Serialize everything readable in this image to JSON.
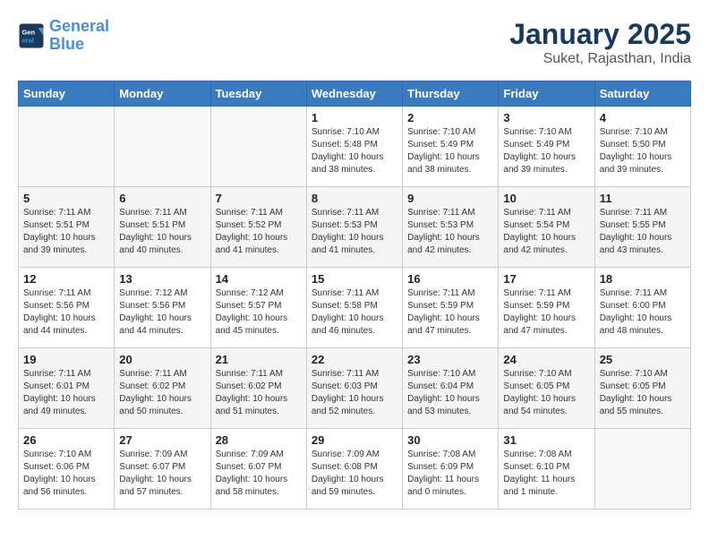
{
  "logo": {
    "line1": "General",
    "line2": "Blue"
  },
  "title": "January 2025",
  "subtitle": "Suket, Rajasthan, India",
  "days_of_week": [
    "Sunday",
    "Monday",
    "Tuesday",
    "Wednesday",
    "Thursday",
    "Friday",
    "Saturday"
  ],
  "weeks": [
    [
      {
        "day": "",
        "info": ""
      },
      {
        "day": "",
        "info": ""
      },
      {
        "day": "",
        "info": ""
      },
      {
        "day": "1",
        "info": "Sunrise: 7:10 AM\nSunset: 5:48 PM\nDaylight: 10 hours\nand 38 minutes."
      },
      {
        "day": "2",
        "info": "Sunrise: 7:10 AM\nSunset: 5:49 PM\nDaylight: 10 hours\nand 38 minutes."
      },
      {
        "day": "3",
        "info": "Sunrise: 7:10 AM\nSunset: 5:49 PM\nDaylight: 10 hours\nand 39 minutes."
      },
      {
        "day": "4",
        "info": "Sunrise: 7:10 AM\nSunset: 5:50 PM\nDaylight: 10 hours\nand 39 minutes."
      }
    ],
    [
      {
        "day": "5",
        "info": "Sunrise: 7:11 AM\nSunset: 5:51 PM\nDaylight: 10 hours\nand 39 minutes."
      },
      {
        "day": "6",
        "info": "Sunrise: 7:11 AM\nSunset: 5:51 PM\nDaylight: 10 hours\nand 40 minutes."
      },
      {
        "day": "7",
        "info": "Sunrise: 7:11 AM\nSunset: 5:52 PM\nDaylight: 10 hours\nand 41 minutes."
      },
      {
        "day": "8",
        "info": "Sunrise: 7:11 AM\nSunset: 5:53 PM\nDaylight: 10 hours\nand 41 minutes."
      },
      {
        "day": "9",
        "info": "Sunrise: 7:11 AM\nSunset: 5:53 PM\nDaylight: 10 hours\nand 42 minutes."
      },
      {
        "day": "10",
        "info": "Sunrise: 7:11 AM\nSunset: 5:54 PM\nDaylight: 10 hours\nand 42 minutes."
      },
      {
        "day": "11",
        "info": "Sunrise: 7:11 AM\nSunset: 5:55 PM\nDaylight: 10 hours\nand 43 minutes."
      }
    ],
    [
      {
        "day": "12",
        "info": "Sunrise: 7:11 AM\nSunset: 5:56 PM\nDaylight: 10 hours\nand 44 minutes."
      },
      {
        "day": "13",
        "info": "Sunrise: 7:12 AM\nSunset: 5:56 PM\nDaylight: 10 hours\nand 44 minutes."
      },
      {
        "day": "14",
        "info": "Sunrise: 7:12 AM\nSunset: 5:57 PM\nDaylight: 10 hours\nand 45 minutes."
      },
      {
        "day": "15",
        "info": "Sunrise: 7:11 AM\nSunset: 5:58 PM\nDaylight: 10 hours\nand 46 minutes."
      },
      {
        "day": "16",
        "info": "Sunrise: 7:11 AM\nSunset: 5:59 PM\nDaylight: 10 hours\nand 47 minutes."
      },
      {
        "day": "17",
        "info": "Sunrise: 7:11 AM\nSunset: 5:59 PM\nDaylight: 10 hours\nand 47 minutes."
      },
      {
        "day": "18",
        "info": "Sunrise: 7:11 AM\nSunset: 6:00 PM\nDaylight: 10 hours\nand 48 minutes."
      }
    ],
    [
      {
        "day": "19",
        "info": "Sunrise: 7:11 AM\nSunset: 6:01 PM\nDaylight: 10 hours\nand 49 minutes."
      },
      {
        "day": "20",
        "info": "Sunrise: 7:11 AM\nSunset: 6:02 PM\nDaylight: 10 hours\nand 50 minutes."
      },
      {
        "day": "21",
        "info": "Sunrise: 7:11 AM\nSunset: 6:02 PM\nDaylight: 10 hours\nand 51 minutes."
      },
      {
        "day": "22",
        "info": "Sunrise: 7:11 AM\nSunset: 6:03 PM\nDaylight: 10 hours\nand 52 minutes."
      },
      {
        "day": "23",
        "info": "Sunrise: 7:10 AM\nSunset: 6:04 PM\nDaylight: 10 hours\nand 53 minutes."
      },
      {
        "day": "24",
        "info": "Sunrise: 7:10 AM\nSunset: 6:05 PM\nDaylight: 10 hours\nand 54 minutes."
      },
      {
        "day": "25",
        "info": "Sunrise: 7:10 AM\nSunset: 6:05 PM\nDaylight: 10 hours\nand 55 minutes."
      }
    ],
    [
      {
        "day": "26",
        "info": "Sunrise: 7:10 AM\nSunset: 6:06 PM\nDaylight: 10 hours\nand 56 minutes."
      },
      {
        "day": "27",
        "info": "Sunrise: 7:09 AM\nSunset: 6:07 PM\nDaylight: 10 hours\nand 57 minutes."
      },
      {
        "day": "28",
        "info": "Sunrise: 7:09 AM\nSunset: 6:07 PM\nDaylight: 10 hours\nand 58 minutes."
      },
      {
        "day": "29",
        "info": "Sunrise: 7:09 AM\nSunset: 6:08 PM\nDaylight: 10 hours\nand 59 minutes."
      },
      {
        "day": "30",
        "info": "Sunrise: 7:08 AM\nSunset: 6:09 PM\nDaylight: 11 hours\nand 0 minutes."
      },
      {
        "day": "31",
        "info": "Sunrise: 7:08 AM\nSunset: 6:10 PM\nDaylight: 11 hours\nand 1 minute."
      },
      {
        "day": "",
        "info": ""
      }
    ]
  ]
}
